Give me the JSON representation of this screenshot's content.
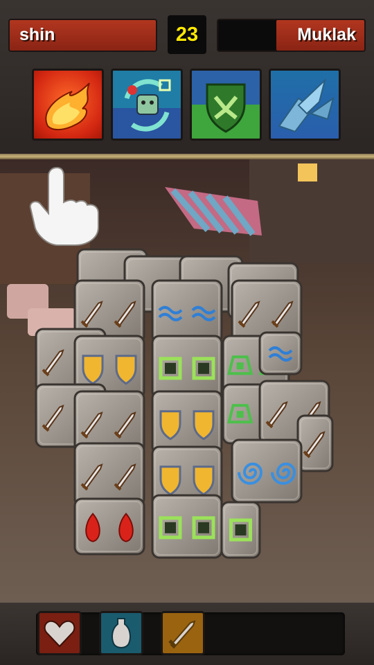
{
  "players": {
    "player1": {
      "name": "shin"
    },
    "player2": {
      "name": "Muklak",
      "health_fraction": 0.6
    }
  },
  "turn_counter": "23",
  "spells": [
    {
      "icon": "fireball-icon",
      "color": "#d42812"
    },
    {
      "icon": "skull-transform-icon",
      "color": "#1f7da6"
    },
    {
      "icon": "shield-break-icon",
      "color": "#3ea63c"
    },
    {
      "icon": "ice-shards-icon",
      "color": "#1f6fa8"
    }
  ],
  "board": {
    "tile_types": [
      "sword-icon",
      "shield-icon",
      "water-icon",
      "green-square-icon",
      "green-rune-icon",
      "spiral-icon",
      "fire-icon"
    ],
    "hint": "pointing-hand-icon"
  },
  "inventory": [
    {
      "icon": "heart-icon",
      "color": "#7a1f12"
    },
    {
      "icon": "potion-vase-icon",
      "color": "#1a5b6e"
    },
    {
      "icon": "sword-icon",
      "color": "#9a6310"
    }
  ]
}
